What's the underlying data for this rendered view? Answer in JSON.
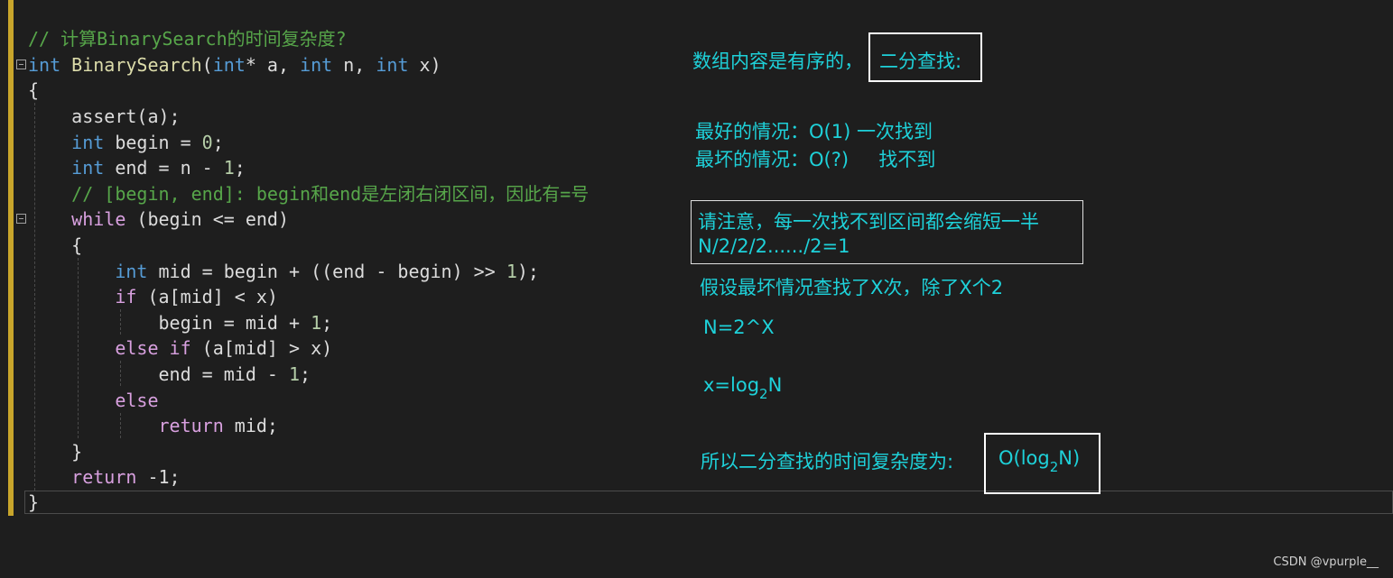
{
  "code": {
    "l1": "// 计算BinarySearch的时间复杂度?",
    "l2": {
      "kw1": "int",
      "fn": "BinarySearch",
      "p1": "(",
      "kw2": "int",
      "p2": "* a, ",
      "kw3": "int",
      "p3": " n, ",
      "kw4": "int",
      "p4": " x)"
    },
    "l3": "{",
    "l4": {
      "fn": "assert",
      "rest": "(a);"
    },
    "l5": {
      "kw": "int",
      "rest": " begin = ",
      "num": "0",
      "end": ";"
    },
    "l6": {
      "kw": "int",
      "rest": " end = n - ",
      "num": "1",
      "end": ";"
    },
    "l7": "// [begin, end]: begin和end是左闭右闭区间，因此有=号",
    "l8": {
      "ctl": "while",
      "rest": " (begin <= end)"
    },
    "l9": "{",
    "l10": {
      "kw": "int",
      "rest": " mid = begin + ((end - begin) >> ",
      "num": "1",
      "end": ");"
    },
    "l11": {
      "ctl": "if",
      "rest": " (a[mid] < x)"
    },
    "l12": {
      "rest": "begin = mid + ",
      "num": "1",
      "end": ";"
    },
    "l13": {
      "ctl1": "else",
      "sp": " ",
      "ctl2": "if",
      "rest": " (a[mid] > x)"
    },
    "l14": {
      "rest": "end = mid - ",
      "num": "1",
      "end": ";"
    },
    "l15": "else",
    "l16": {
      "ctl": "return",
      "rest": " mid;"
    },
    "l17": "}",
    "l18": {
      "ctl": "return",
      "rest": " -1;"
    },
    "l19": "}"
  },
  "notes": {
    "intro": "数组内容是有序的，",
    "intro_boxed": "二分查找:",
    "best": "最好的情况：O(1) 一次找到",
    "worst": "最坏的情况：O(?)     找不到",
    "attention1": "请注意，每一次找不到区间都会缩短一半",
    "attention2": "N/2/2/2....../2=1",
    "assume": "假设最坏情况查找了X次，除了X个2",
    "eq1": "N=2^X",
    "eq2_pre": "x=log",
    "eq2_sub": "2",
    "eq2_post": "N",
    "conclusion": "所以二分查找的时间复杂度为:",
    "result_pre": "O(log",
    "result_sub": "2",
    "result_post": "N)"
  },
  "watermark": "CSDN @vpurple__",
  "colors": {
    "annotation": "#1ed1d9",
    "keyword": "#569cd6",
    "control": "#d8a0df",
    "comment": "#57a64a",
    "function": "#dcdcaa"
  }
}
